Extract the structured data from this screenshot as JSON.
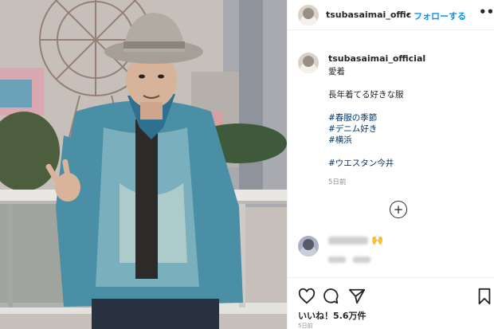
{
  "post": {
    "username_header": "tsubasaimai_offic",
    "dot": "•",
    "follow_label": "フォローする",
    "more_glyph": "•••",
    "caption": {
      "username": "tsubasaimai_official",
      "lines": [
        "愛着",
        "長年着てる好きな服",
        "#春服の季節",
        "#デニム好き",
        "#横浜",
        "#ウエスタン今井"
      ],
      "time": "5日前"
    },
    "load_more_glyph": "+",
    "comment_emoji": "🙌",
    "likes": "いいね！5.6万件",
    "date": "5日前"
  },
  "colors": {
    "accent": "#0095f6",
    "hashtag": "#00376b",
    "text": "#262626",
    "muted": "#8e8e8e"
  },
  "icons": [
    "heart-icon",
    "comment-icon",
    "share-icon",
    "bookmark-icon",
    "more-icon",
    "add-circle-icon"
  ]
}
